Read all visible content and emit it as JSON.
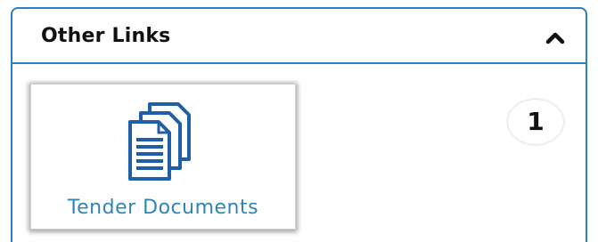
{
  "panel": {
    "title": "Other Links",
    "toggle_icon": "chevron-up-icon",
    "border_color": "#2e7fbd"
  },
  "tiles": [
    {
      "label": "Tender Documents",
      "icon": "documents-icon",
      "label_color": "#2e85b6"
    }
  ],
  "badge": {
    "count": "1"
  }
}
